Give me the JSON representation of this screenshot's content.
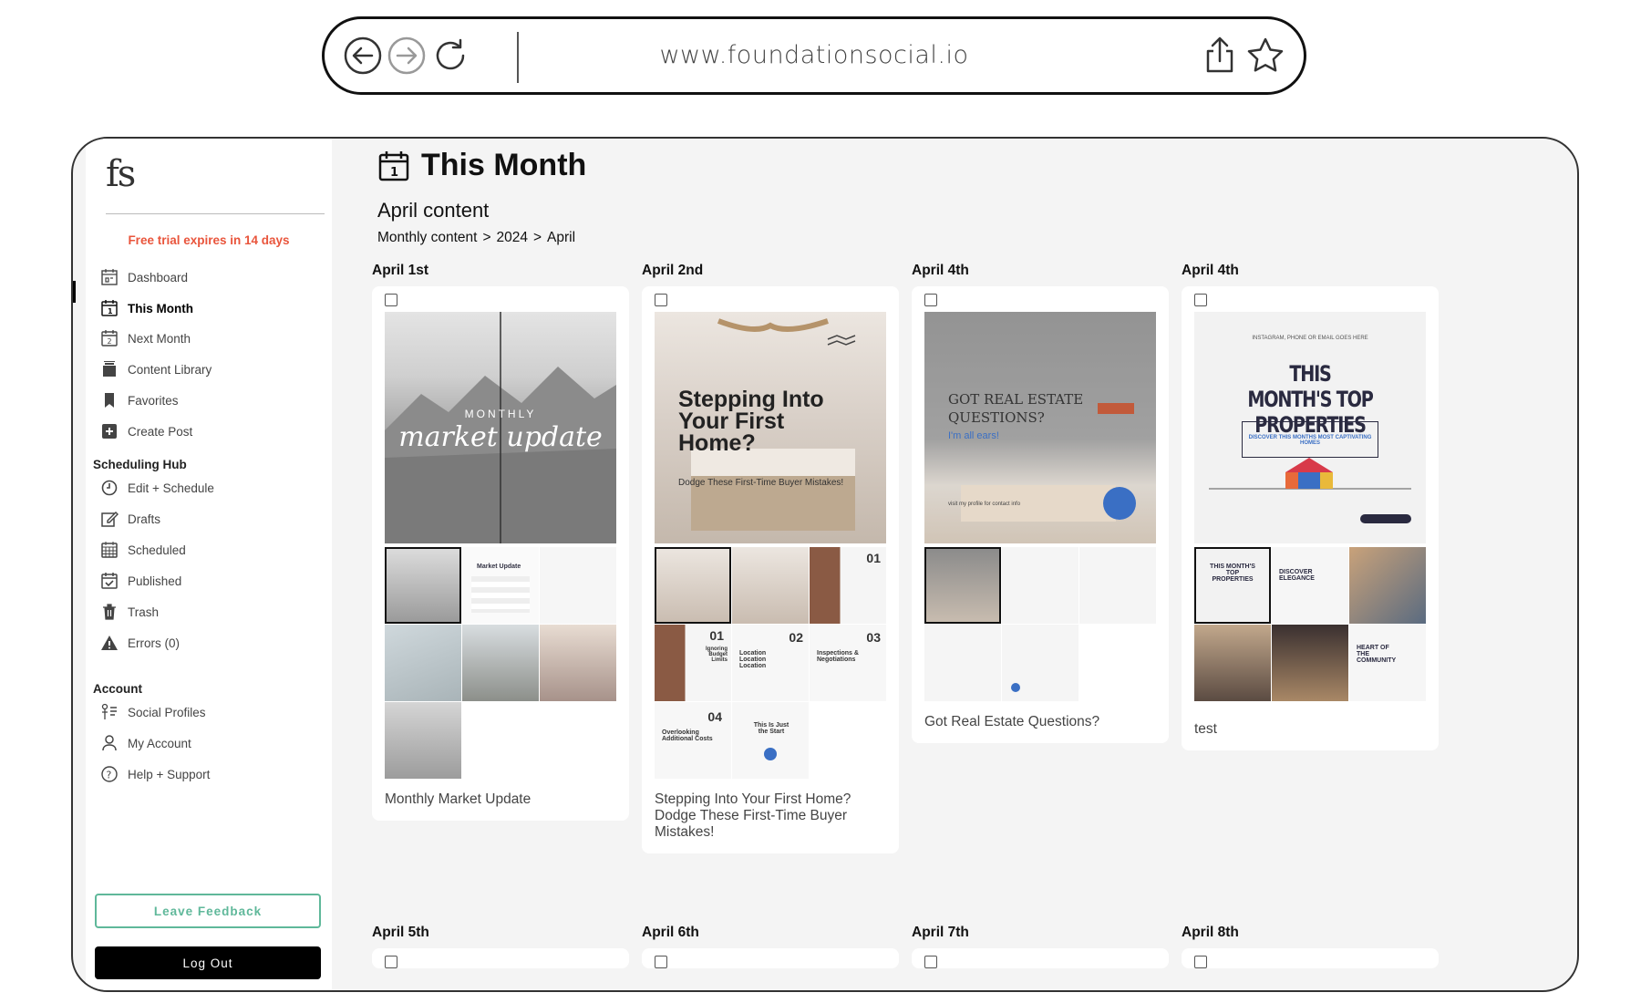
{
  "browser": {
    "url": "www.foundationsocial.io"
  },
  "sidebar": {
    "logo": "fs",
    "trial_notice": "Free trial expires in 14 days",
    "items": [
      {
        "label": "Dashboard",
        "icon": "dashboard-calendar-icon"
      },
      {
        "label": "This Month",
        "icon": "calendar-1-icon",
        "active": true
      },
      {
        "label": "Next Month",
        "icon": "calendar-2-icon"
      },
      {
        "label": "Content Library",
        "icon": "library-icon"
      },
      {
        "label": "Favorites",
        "icon": "bookmark-icon"
      },
      {
        "label": "Create Post",
        "icon": "plus-square-icon"
      }
    ],
    "scheduling_title": "Scheduling Hub",
    "scheduling_items": [
      {
        "label": "Edit + Schedule",
        "icon": "clock-icon"
      },
      {
        "label": "Drafts",
        "icon": "edit-icon"
      },
      {
        "label": "Scheduled",
        "icon": "calendar-grid-icon"
      },
      {
        "label": "Published",
        "icon": "calendar-check-icon"
      },
      {
        "label": "Trash",
        "icon": "trash-icon"
      },
      {
        "label": "Errors (0)",
        "icon": "warning-icon"
      }
    ],
    "account_title": "Account",
    "account_items": [
      {
        "label": "Social Profiles",
        "icon": "profiles-icon"
      },
      {
        "label": "My Account",
        "icon": "user-icon"
      },
      {
        "label": "Help + Support",
        "icon": "help-icon"
      }
    ],
    "feedback_label": "Leave Feedback",
    "logout_label": "Log Out"
  },
  "main": {
    "title": "This Month",
    "subtitle": "April content",
    "breadcrumb": [
      "Monthly content",
      ">",
      "2024",
      ">",
      "April"
    ],
    "columns": [
      {
        "date": "April 1st",
        "caption": "Monthly Market Update",
        "hero": {
          "overline": "MONTHLY",
          "script": "market update"
        }
      },
      {
        "date": "April 2nd",
        "caption": "Stepping Into Your First Home? Dodge These First-Time Buyer Mistakes!",
        "hero": {
          "headline": "Stepping Into Your First Home?",
          "sub": "Dodge These First-Time Buyer Mistakes!"
        }
      },
      {
        "date": "April 4th",
        "caption": "Got Real Estate Questions?",
        "hero": {
          "headline": "GOT REAL ESTATE QUESTIONS?",
          "sub": "I'm all ears!",
          "foot": "visit my profile for contact info"
        }
      },
      {
        "date": "April 4th",
        "caption": "test",
        "hero": {
          "top": "INSTAGRAM, PHONE OR EMAIL GOES HERE",
          "headline": "THIS MONTH'S TOP PROPERTIES",
          "box": "DISCOVER THIS MONTHS MOST CAPTIVATING HOMES"
        }
      }
    ],
    "next_columns": [
      "April 5th",
      "April 6th",
      "April 7th",
      "April 8th"
    ],
    "thumb_labels": {
      "market_update": "Market Update",
      "ignoring": "Ignoring Budget Limits",
      "location": "Location Location Location",
      "inspections": "Inspections & Negotiations",
      "overlooking": "Overlooking Additional Costs",
      "just_start": "This Is Just the Start",
      "n01": "01",
      "n02": "02",
      "n03": "03",
      "n04": "04",
      "discover": "DISCOVER ELEGANCE",
      "heart": "HEART OF THE COMMUNITY",
      "top_props": "THIS MONTH'S TOP PROPERTIES"
    }
  },
  "colors": {
    "accent_red": "#e9553c",
    "feedback_green": "#5fb89a",
    "question_blue": "#3a6fc4"
  }
}
